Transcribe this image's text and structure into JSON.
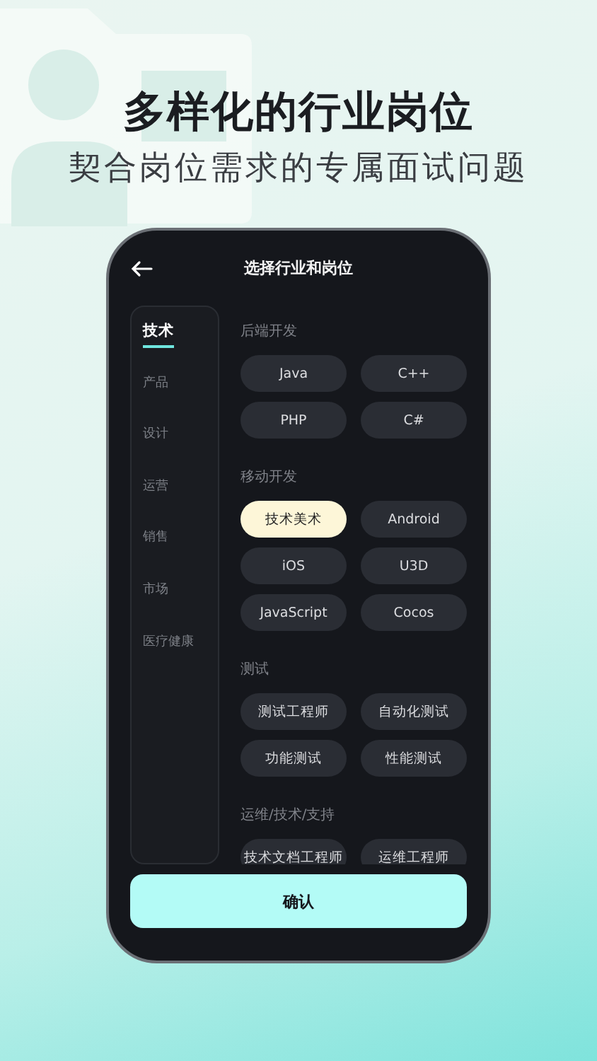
{
  "headline": "多样化的行业岗位",
  "subheadline": "契合岗位需求的专属面试问题",
  "screen": {
    "title": "选择行业和岗位",
    "categories": [
      {
        "label": "技术",
        "selected": true
      },
      {
        "label": "产品",
        "selected": false
      },
      {
        "label": "设计",
        "selected": false
      },
      {
        "label": "运营",
        "selected": false
      },
      {
        "label": "销售",
        "selected": false
      },
      {
        "label": "市场",
        "selected": false
      },
      {
        "label": "医疗健康",
        "selected": false
      }
    ],
    "sections": [
      {
        "title": "后端开发",
        "positions": [
          {
            "label": "Java",
            "selected": false
          },
          {
            "label": "C++",
            "selected": false
          },
          {
            "label": "PHP",
            "selected": false
          },
          {
            "label": "C#",
            "selected": false
          }
        ]
      },
      {
        "title": "移动开发",
        "positions": [
          {
            "label": "技术美术",
            "selected": true
          },
          {
            "label": "Android",
            "selected": false
          },
          {
            "label": "iOS",
            "selected": false
          },
          {
            "label": "U3D",
            "selected": false
          },
          {
            "label": "JavaScript",
            "selected": false
          },
          {
            "label": "Cocos",
            "selected": false
          }
        ]
      },
      {
        "title": "测试",
        "positions": [
          {
            "label": "测试工程师",
            "selected": false
          },
          {
            "label": "自动化测试",
            "selected": false
          },
          {
            "label": "功能测试",
            "selected": false
          },
          {
            "label": "性能测试",
            "selected": false
          }
        ]
      },
      {
        "title": "运维/技术/支持",
        "positions": [
          {
            "label": "技术文档工程师",
            "selected": false
          },
          {
            "label": "运维工程师",
            "selected": false
          }
        ]
      }
    ],
    "confirm_button": "确认"
  }
}
